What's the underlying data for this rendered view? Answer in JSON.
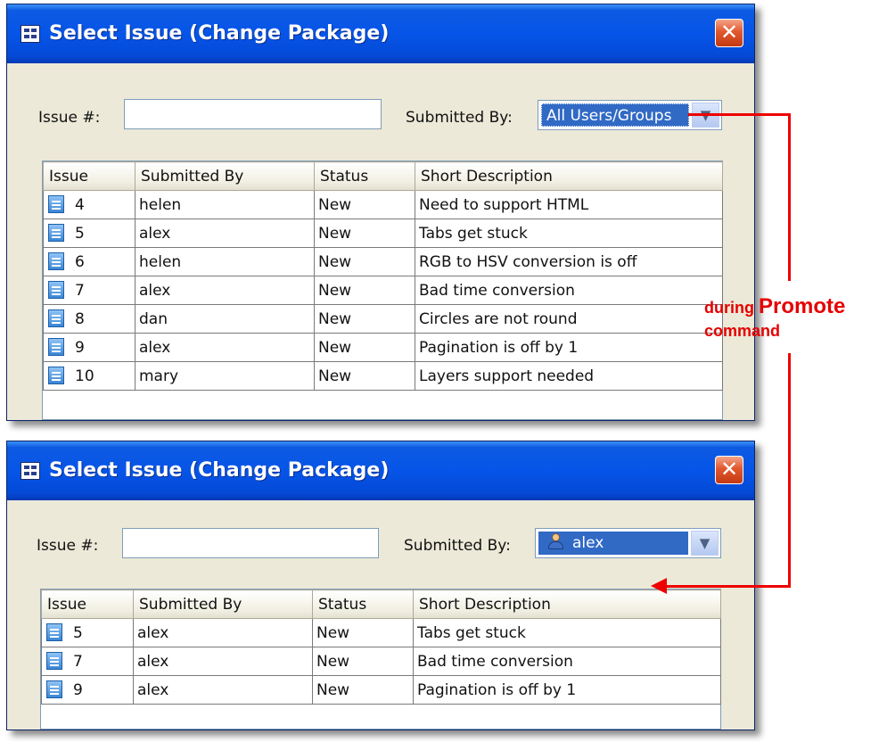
{
  "dialogs": [
    {
      "title": "Select Issue (Change Package)",
      "close_glyph": "✕",
      "issue_label": "Issue #:",
      "issue_value": "",
      "submitted_by_label": "Submitted By:",
      "submitted_by_value": "All Users/Groups",
      "columns": [
        "Issue",
        "Submitted By",
        "Status",
        "Short Description"
      ],
      "rows": [
        {
          "issue": "4",
          "submitted_by": "helen",
          "status": "New",
          "description": "Need to support HTML"
        },
        {
          "issue": "5",
          "submitted_by": "alex",
          "status": "New",
          "description": "Tabs get stuck"
        },
        {
          "issue": "6",
          "submitted_by": "helen",
          "status": "New",
          "description": "RGB to HSV conversion is off"
        },
        {
          "issue": "7",
          "submitted_by": "alex",
          "status": "New",
          "description": "Bad time conversion"
        },
        {
          "issue": "8",
          "submitted_by": "dan",
          "status": "New",
          "description": "Circles are not round"
        },
        {
          "issue": "9",
          "submitted_by": "alex",
          "status": "New",
          "description": "Pagination is off by 1"
        },
        {
          "issue": "10",
          "submitted_by": "mary",
          "status": "New",
          "description": "Layers support needed"
        }
      ]
    },
    {
      "title": "Select Issue (Change Package)",
      "close_glyph": "✕",
      "issue_label": "Issue #:",
      "issue_value": "",
      "submitted_by_label": "Submitted By:",
      "submitted_by_value": "alex",
      "submitted_by_icon": "user-icon",
      "columns": [
        "Issue",
        "Submitted By",
        "Status",
        "Short Description"
      ],
      "rows": [
        {
          "issue": "5",
          "submitted_by": "alex",
          "status": "New",
          "description": "Tabs get stuck"
        },
        {
          "issue": "7",
          "submitted_by": "alex",
          "status": "New",
          "description": "Bad time conversion"
        },
        {
          "issue": "9",
          "submitted_by": "alex",
          "status": "New",
          "description": "Pagination is off by 1"
        }
      ]
    }
  ],
  "annotation": {
    "prefix": "during",
    "keyword": "Promote",
    "suffix": "command",
    "color": "#e60000"
  },
  "icons": {
    "app": "app-window-icon",
    "close": "close-icon",
    "dropdown": "chevron-down-icon",
    "issue": "issue-document-icon",
    "user": "user-icon"
  },
  "colors": {
    "titlebar": "#0655e8",
    "window_bg": "#ece9d8",
    "selection": "#316ac5",
    "close_button": "#e2582d"
  }
}
